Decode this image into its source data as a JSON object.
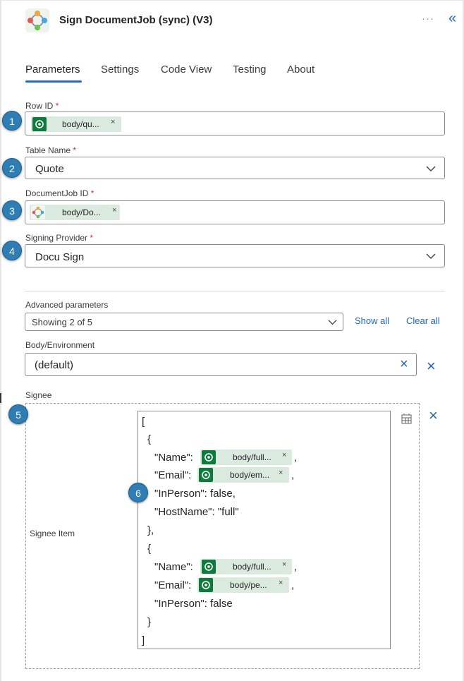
{
  "header": {
    "title": "Sign DocumentJob (sync) (V3)",
    "more_label": "···",
    "collapse_label": "«"
  },
  "tabs": [
    {
      "label": "Parameters",
      "active": true
    },
    {
      "label": "Settings",
      "active": false
    },
    {
      "label": "Code View",
      "active": false
    },
    {
      "label": "Testing",
      "active": false
    },
    {
      "label": "About",
      "active": false
    }
  ],
  "required_mark": "*",
  "fields": {
    "row_id": {
      "label": "Row ID",
      "token": "body/qu...",
      "token_close": "×",
      "badge": "1"
    },
    "table_name": {
      "label": "Table Name",
      "value": "Quote",
      "badge": "2"
    },
    "documentjob_id": {
      "label": "DocumentJob ID",
      "token": "body/Do...",
      "token_close": "×",
      "badge": "3"
    },
    "signing_provider": {
      "label": "Signing Provider",
      "value": "Docu Sign",
      "badge": "4"
    }
  },
  "advanced": {
    "label": "Advanced parameters",
    "value": "Showing 2 of 5",
    "show_all": "Show all",
    "clear_all": "Clear all"
  },
  "environment": {
    "label": "Body/Environment",
    "value": "(default)",
    "clear_icon": "×",
    "remove_icon": "×"
  },
  "signee": {
    "label": "Signee",
    "badge": "5",
    "item_label": "Signee Item",
    "code_badge": "6",
    "remove_icon": "×",
    "lines": {
      "open_bracket": "[",
      "open_brace1": "{",
      "name1_key": "\"Name\":",
      "name1_token": "body/full...",
      "email1_key": "\"Email\":",
      "email1_token": "body/em...",
      "inperson1": "\"InPerson\": false,",
      "hostname1": "\"HostName\": \"full\"",
      "close_brace1": "},",
      "open_brace2": "{",
      "name2_key": "\"Name\":",
      "name2_token": "body/full...",
      "email2_key": "\"Email\":",
      "email2_token": "body/pe...",
      "inperson2": "\"InPerson\": false",
      "close_brace2": "}",
      "close_bracket": "]",
      "comma": ",",
      "token_close": "×"
    }
  },
  "colors": {
    "accent": "#2266b8",
    "badge": "#2e7db5",
    "token_bg": "#dbeadf",
    "token_icon": "#0e7a3c",
    "required": "#c4314b"
  }
}
